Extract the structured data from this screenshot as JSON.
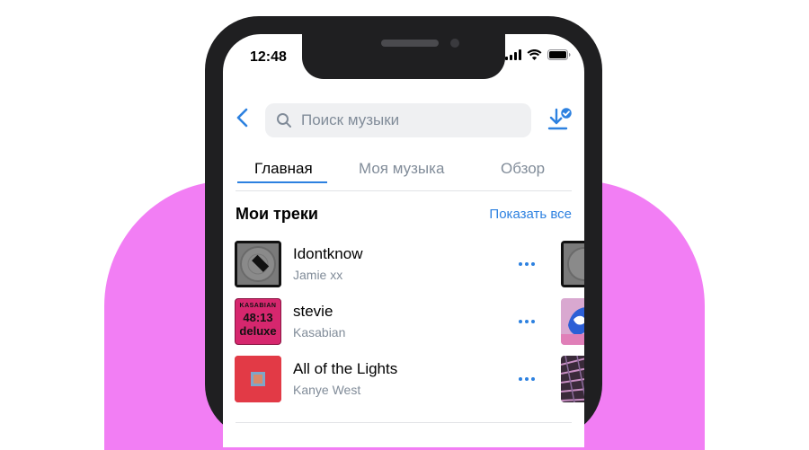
{
  "status_bar": {
    "time": "12:48"
  },
  "header": {
    "search_placeholder": "Поиск музыки"
  },
  "tabs": [
    {
      "label": "Главная",
      "active": true
    },
    {
      "label": "Моя музыка",
      "active": false
    },
    {
      "label": "Обзор",
      "active": false
    }
  ],
  "section": {
    "title": "Мои треки",
    "show_all": "Показать все"
  },
  "tracks": [
    {
      "title": "Idontknow",
      "artist": "Jamie xx"
    },
    {
      "title": "stevie",
      "artist": "Kasabian",
      "cover_text": {
        "line1": "KASABIAN",
        "line2": "48:13",
        "line3": "deluxe"
      }
    },
    {
      "title": "All of the Lights",
      "artist": "Kanye West"
    }
  ],
  "colors": {
    "accent": "#2d81e0",
    "background_blob": "#f27ef4",
    "secondary_text": "#818c99"
  }
}
